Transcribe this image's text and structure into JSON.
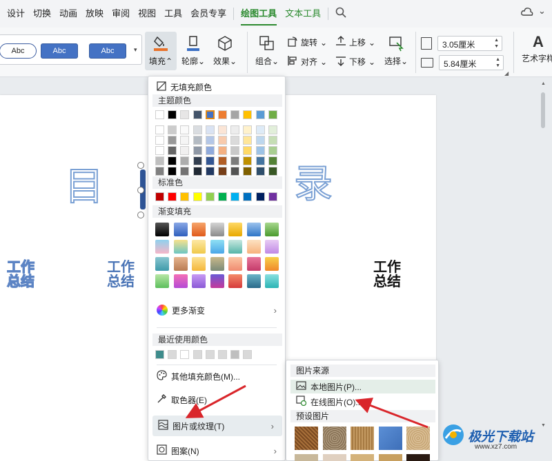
{
  "tabs": [
    {
      "label": "设计",
      "active": false
    },
    {
      "label": "切换",
      "active": false
    },
    {
      "label": "动画",
      "active": false
    },
    {
      "label": "放映",
      "active": false
    },
    {
      "label": "审阅",
      "active": false
    },
    {
      "label": "视图",
      "active": false
    },
    {
      "label": "工具",
      "active": false
    },
    {
      "label": "会员专享",
      "active": false
    },
    {
      "label": "绘图工具",
      "active": true
    },
    {
      "label": "文本工具",
      "active": false
    }
  ],
  "ribbon": {
    "styles": [
      "Abc",
      "Abc",
      "Abc"
    ],
    "fill_label": "填充",
    "outline_label": "轮廓",
    "effect_label": "效果",
    "group_label": "组合",
    "rotate_label": "旋转",
    "align_label": "对齐",
    "up_label": "上移",
    "down_label": "下移",
    "select_label": "选择",
    "height_value": "3.05厘米",
    "width_value": "5.84厘米",
    "art_label": "艺术字样"
  },
  "slide": {
    "char_left": "目",
    "char_right": "录",
    "summary_1": "工作总结",
    "summary_2": "工作总结",
    "summary_3": "工作总结"
  },
  "fill_menu": {
    "no_fill": "无填充颜色",
    "theme_colors": "主题颜色",
    "standard_colors": "标准色",
    "gradient_fill": "渐变填充",
    "more_gradients": "更多渐变",
    "recent_colors": "最近使用颜色",
    "other_colors": "其他填充颜色(M)...",
    "eyedropper": "取色器(E)",
    "picture_texture": "图片或纹理(T)",
    "pattern": "图案(N)",
    "theme_row": [
      "#ffffff",
      "#000000",
      "#e7e6e6",
      "#44546a",
      "#4472c4",
      "#ed7d31",
      "#a5a5a5",
      "#ffc000",
      "#5b9bd5",
      "#70ad47"
    ],
    "standard_row": [
      "#c00000",
      "#ff0000",
      "#ffc000",
      "#ffff00",
      "#92d050",
      "#00b050",
      "#00b0f0",
      "#0070c0",
      "#002060",
      "#7030a0"
    ],
    "recent_row": [
      "#3e8c8c",
      "#d9d9d9",
      "#ffffff",
      "#d9d9d9",
      "#d9d9d9",
      "#d9d9d9",
      "#bfbfbf",
      "#d9d9d9"
    ]
  },
  "picture_menu": {
    "source_title": "图片来源",
    "local_picture": "本地图片(P)...",
    "online_picture": "在线图片(O)...",
    "preset_title": "预设图片"
  },
  "watermark": {
    "brand": "极光下载站",
    "url": "www.xz7.com"
  }
}
